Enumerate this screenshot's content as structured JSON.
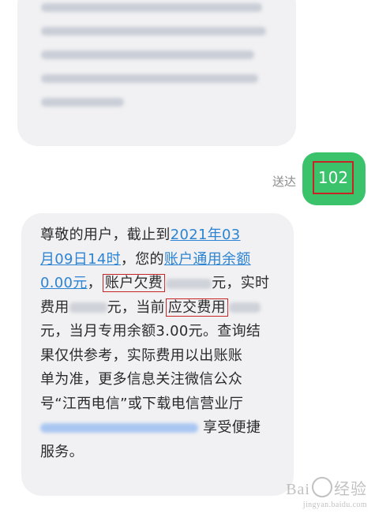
{
  "sent": {
    "status": "送达",
    "message": "102"
  },
  "incoming": {
    "part1": "尊敬的用户，截止到",
    "date_link_a": "2021年03",
    "date_link_b": "月09日14时",
    "part2": "，您的",
    "balance_label": "账户通用余额",
    "balance_value": "0.00元",
    "part3": "，",
    "arrears_label": "账户欠费",
    "part4": "元，实时",
    "part5": "费用",
    "part6": "元，当前",
    "due_label": "应交费用",
    "part7": "元，当月专用余额3.00元。查询结",
    "part8": "果仅供参考，实际费用以出账账",
    "part9": "单为准，更多信息关注微信公众",
    "part10": "号“江西电信”或下载电信营业厅",
    "part11": "享受便捷",
    "part12": "服务。"
  },
  "watermark": {
    "brand_a": "Bai",
    "brand_b": "经验",
    "url": "jingyan.baidu.com"
  },
  "colors": {
    "sent_bubble": "#3ac36b",
    "incoming_bubble": "#f1f1f3",
    "link": "#2c84d3",
    "highlight_box": "#c52525"
  }
}
